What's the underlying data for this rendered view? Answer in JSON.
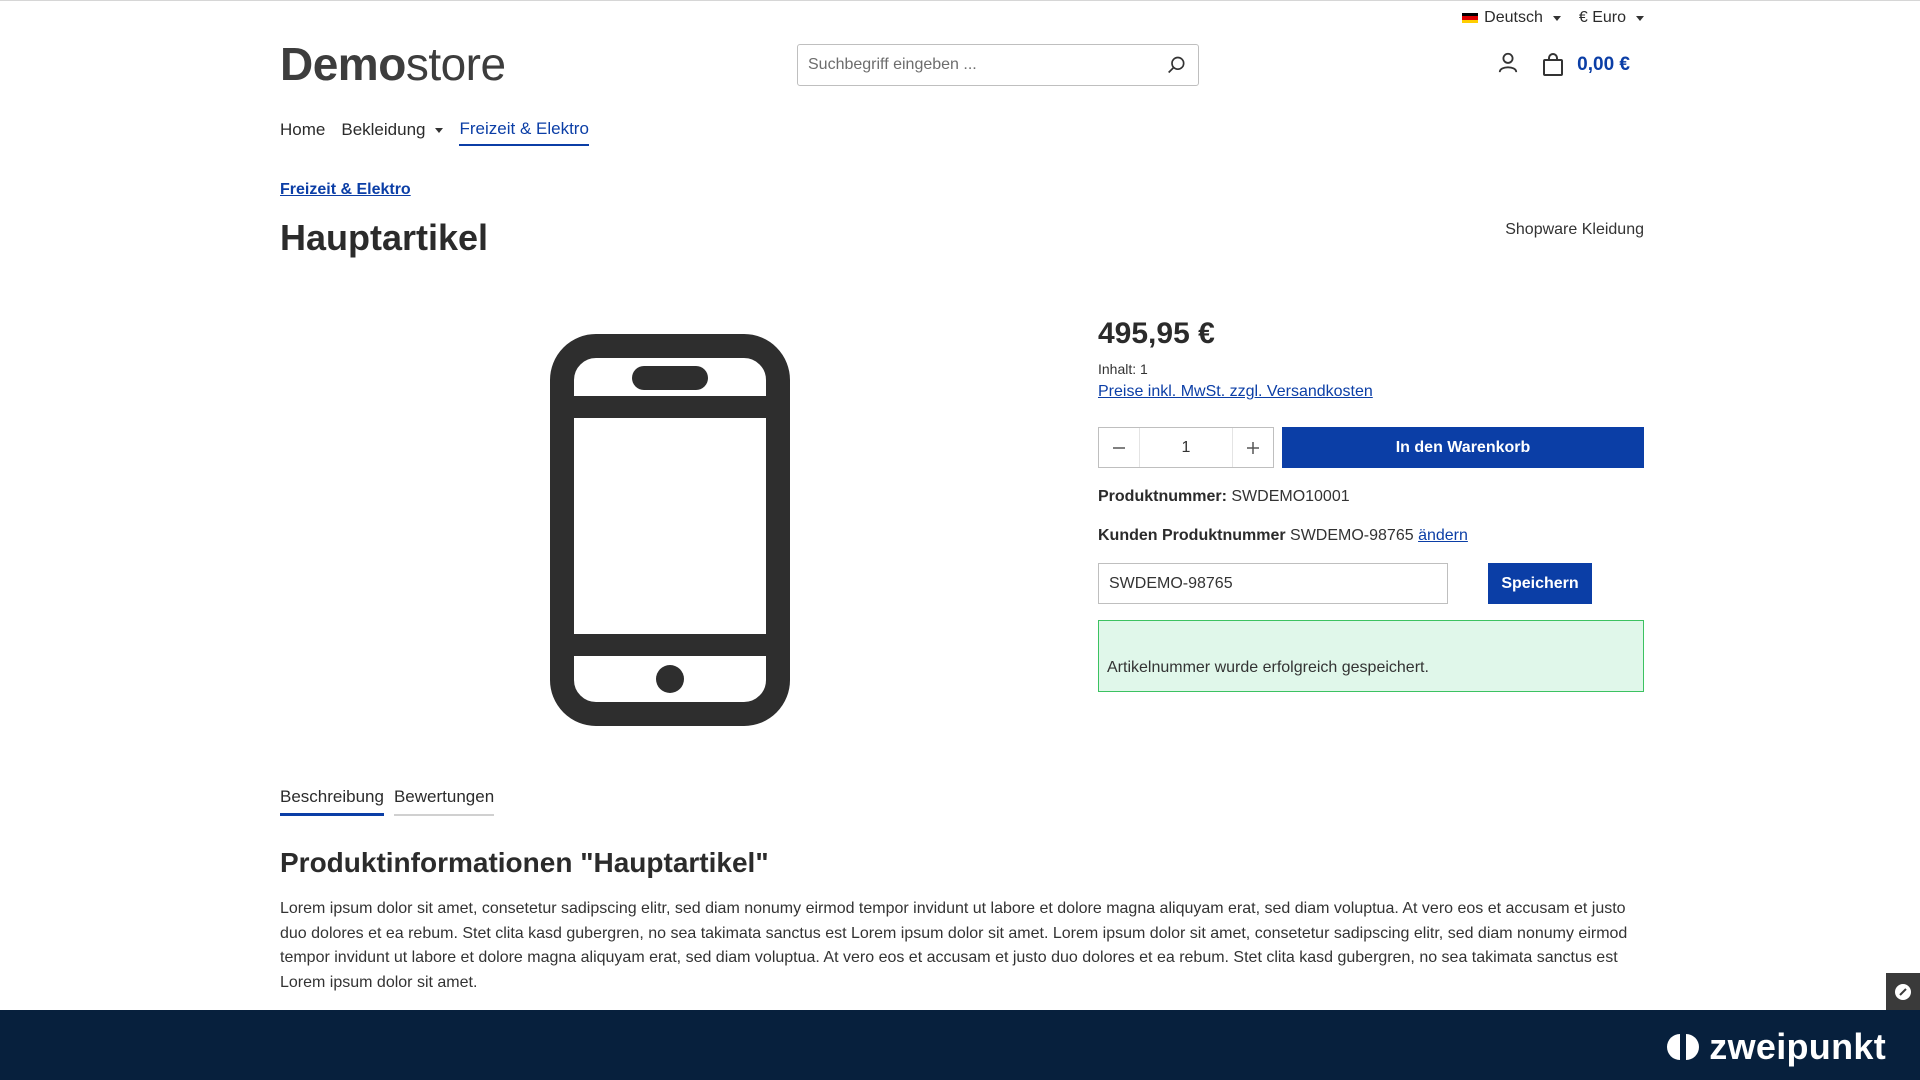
{
  "topbar": {
    "language": "Deutsch",
    "currency": "€ Euro"
  },
  "header": {
    "logo_bold": "Demo",
    "logo_light": "store",
    "search_placeholder": "Suchbegriff eingeben ...",
    "cart_total": "0,00 €"
  },
  "nav": {
    "items": [
      {
        "label": "Home"
      },
      {
        "label": "Bekleidung"
      },
      {
        "label": "Freizeit & Elektro"
      }
    ]
  },
  "breadcrumb": "Freizeit & Elektro",
  "product": {
    "title": "Hauptartikel",
    "manufacturer": "Shopware Kleidung",
    "price": "495,95 €",
    "content_info": "Inhalt: 1",
    "tax_link": "Preise inkl. MwSt. zzgl. Versandkosten",
    "quantity": "1",
    "add_to_cart_label": "In den Warenkorb",
    "product_number_label": "Produktnummer:",
    "product_number": "SWDEMO10001",
    "customer_number_label": "Kunden Produktnummer",
    "customer_number": "SWDEMO-98765",
    "change_link": "ändern",
    "customer_input_value": "SWDEMO-98765",
    "save_label": "Speichern",
    "success_message": "Artikelnummer wurde erfolgreich gespeichert."
  },
  "tabs": [
    {
      "label": "Beschreibung"
    },
    {
      "label": "Bewertungen"
    }
  ],
  "description": {
    "title": "Produktinformationen \"Hauptartikel\"",
    "text": "Lorem ipsum dolor sit amet, consetetur sadipscing elitr, sed diam nonumy eirmod tempor invidunt ut labore et dolore magna aliquyam erat, sed diam voluptua. At vero eos et accusam et justo duo dolores et ea rebum. Stet clita kasd gubergren, no sea takimata sanctus est Lorem ipsum dolor sit amet. Lorem ipsum dolor sit amet, consetetur sadipscing elitr, sed diam nonumy eirmod tempor invidunt ut labore et dolore magna aliquyam erat, sed diam voluptua. At vero eos et accusam et justo duo dolores et ea rebum. Stet clita kasd gubergren, no sea takimata sanctus est Lorem ipsum dolor sit amet."
  },
  "footer": {
    "brand": "zweipunkt"
  },
  "colors": {
    "primary": "#0b3ea6",
    "success_bg": "#e0f7ea",
    "success_border": "#3cc261",
    "footer_bg": "#07203d"
  },
  "icons": {
    "search": "search-icon",
    "account": "user-icon",
    "cart": "shopping-bag-icon",
    "product": "smartphone-icon",
    "flag": "german-flag-icon",
    "brand": "zweipunkt-logo-icon"
  }
}
